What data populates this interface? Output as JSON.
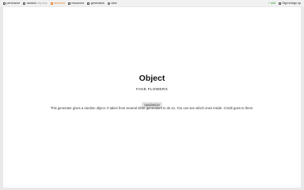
{
  "nav": {
    "items": [
      {
        "label": "perchance",
        "sub": "",
        "icon": "home-icon",
        "active": false
      },
      {
        "label": "random",
        "sub": "obj.cmp",
        "icon": "page-icon",
        "active": false
      },
      {
        "label": "remix/ed",
        "sub": "",
        "icon": "edit-icon",
        "active": true
      },
      {
        "label": "resources",
        "sub": "",
        "icon": "book-icon",
        "active": false
      },
      {
        "label": "generators",
        "sub": "",
        "icon": "list-icon",
        "active": false
      },
      {
        "label": "view",
        "sub": "",
        "icon": "eye-icon",
        "active": false
      }
    ],
    "add_label": "+ add",
    "signin_label": "Sign in/sign up"
  },
  "main": {
    "title": "Object",
    "result": "FAKE FLOWERS",
    "button_label": "randomize",
    "description": "This generator gives a random object. It takes from several other generators to do so. You can see which ones inside. Credit goes to them."
  }
}
